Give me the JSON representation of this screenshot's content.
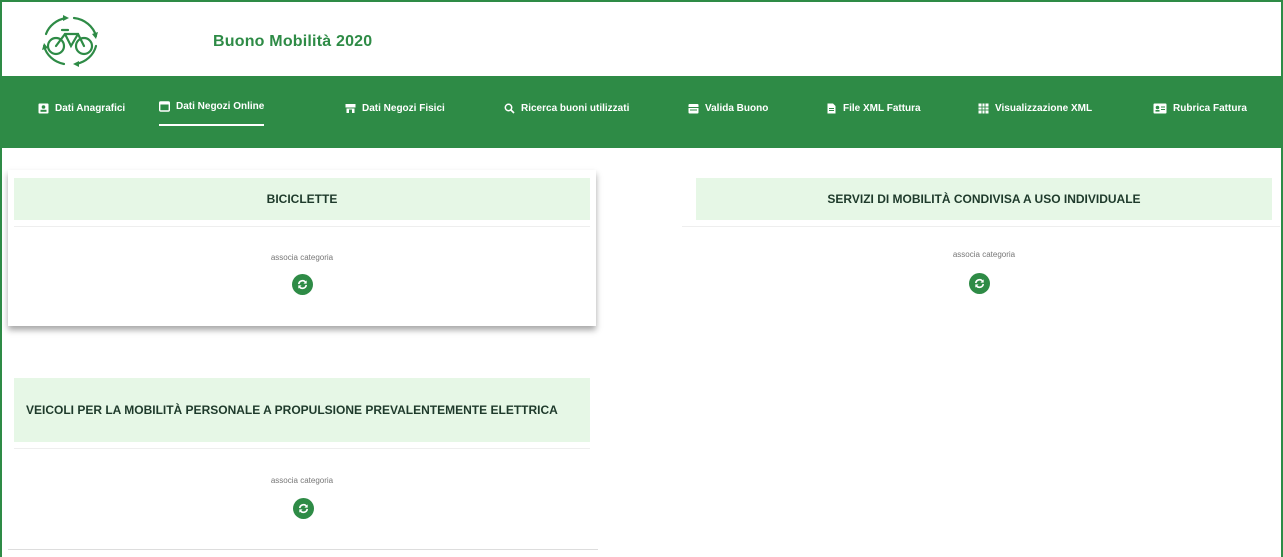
{
  "app": {
    "title": "Buono Mobilità 2020",
    "logo_icon": "bicycle-recycle-logo",
    "accent_color": "#2e8b46",
    "header_bg_color": "#e6f7e6"
  },
  "nav": {
    "items": [
      {
        "label": "Dati Anagrafici",
        "icon": "id-card-icon"
      },
      {
        "label": "Dati Negozi Online",
        "icon": "browser-window-icon",
        "active": true
      },
      {
        "label": "Dati Negozi Fisici",
        "icon": "store-icon"
      },
      {
        "label": "Ricerca buoni utilizzati",
        "icon": "search-icon"
      },
      {
        "label": "Valida Buono",
        "icon": "calendar-check-icon"
      },
      {
        "label": "File XML Fattura",
        "icon": "file-icon"
      },
      {
        "label": "Visualizzazione XML",
        "icon": "grid-icon"
      },
      {
        "label": "Rubrica Fattura",
        "icon": "contact-card-icon"
      }
    ]
  },
  "categories": [
    {
      "title": "BICICLETTE",
      "action_label": "associa categoria",
      "action_icon": "refresh-icon"
    },
    {
      "title": "SERVIZI DI MOBILITÀ CONDIVISA A USO INDIVIDUALE",
      "action_label": "associa categoria",
      "action_icon": "refresh-icon"
    },
    {
      "title": "VEICOLI PER LA MOBILITÀ PERSONALE A PROPULSIONE PREVALENTEMENTE ELETTRICA",
      "action_label": "associa categoria",
      "action_icon": "refresh-icon"
    }
  ]
}
